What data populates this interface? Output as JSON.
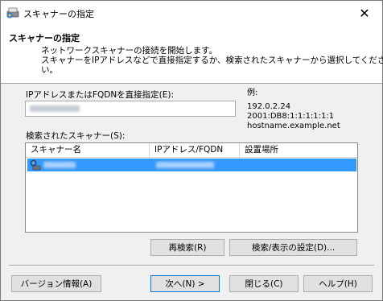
{
  "window": {
    "title": "スキャナーの指定",
    "close_glyph": "✕"
  },
  "header": {
    "title": "スキャナーの指定",
    "description_line1": "ネットワークスキャナーの接続を開始します。",
    "description_line2": "スキャナーをIPアドレスなどで直接指定するか、検索されたスキャナーから選択してくださ",
    "description_line3": "い。"
  },
  "direct": {
    "label": "IPアドレスまたはFQDNを直接指定(E):",
    "value": ""
  },
  "example": {
    "title": "例:",
    "lines": [
      "192.0.2.24",
      "2001:DB8:1:1:1:1:1:1",
      "hostname.example.net"
    ]
  },
  "found": {
    "label": "検索されたスキャナー(S):",
    "columns": [
      "スキャナー名",
      "IPアドレス/FQDN",
      "設置場所"
    ]
  },
  "buttons": {
    "research": "再検索(R)",
    "settings": "検索/表示の設定(D)...",
    "version": "バージョン情報(A)",
    "next": "次へ(N) >",
    "close": "閉じる(C)",
    "help": "ヘルプ(H)"
  },
  "icons": {
    "app": "scanner-app-icon",
    "row": "network-scanner-icon"
  },
  "colors": {
    "selection": "#3399ff",
    "dialog_bg": "#f0f0f0",
    "button_bg": "#e1e1e1"
  }
}
